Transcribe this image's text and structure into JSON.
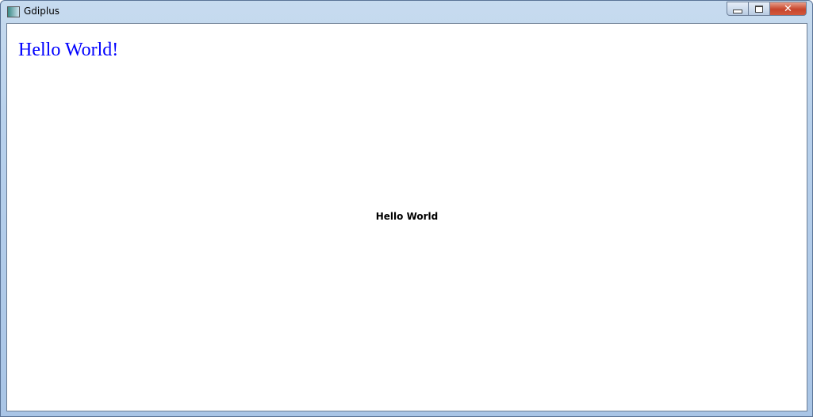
{
  "window": {
    "title": "Gdiplus",
    "icon": "app-window-icon",
    "buttons": {
      "minimize": "minimize-icon",
      "maximize": "maximize-icon",
      "close": "close-icon"
    }
  },
  "client": {
    "serif_text": "Hello World!",
    "serif_color": "#0000ff",
    "center_text": "Hello World"
  }
}
